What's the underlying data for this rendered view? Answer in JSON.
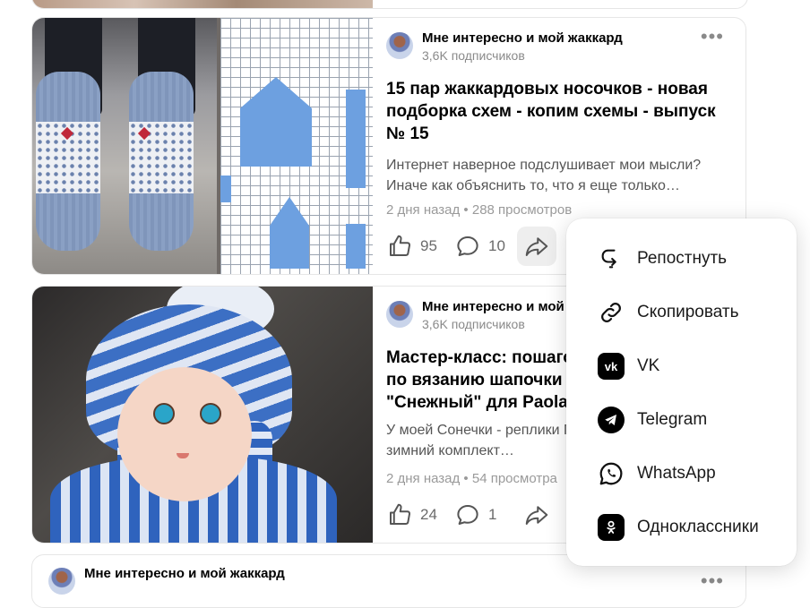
{
  "feed": {
    "items": [
      {
        "channel": "Мне интересно и мой жаккард",
        "subscribers": "3,6K подписчиков",
        "title": "15 пар жаккардовых носочков - новая подборка схем - копим схемы - выпуск № 15",
        "snippet": "Интернет наверное подслушивает мои мысли? Иначе как объяснить то, что я еще только…",
        "meta": "2 дня назад • 288 просмотров",
        "likes": "95",
        "comments": "10"
      },
      {
        "channel": "Мне интересно и мой жаккард",
        "subscribers": "3,6K подписчиков",
        "title": "Мастер-класс: пошаговое руководство по вязанию шапочки из комплекта \"Снежный\" для Paola Reina",
        "snippet": "У моей Сонечки - реплики Паолы появился теплый зимний комплект…",
        "meta": "2 дня назад • 54 просмотра",
        "likes": "24",
        "comments": "1"
      },
      {
        "channel": "Мне интересно и мой жаккард"
      }
    ],
    "more_icon": "more-dots-icon"
  },
  "share_menu": {
    "items": [
      {
        "label": "Репостнуть",
        "icon": "repost-icon"
      },
      {
        "label": "Скопировать",
        "icon": "link-icon"
      },
      {
        "label": "VK",
        "icon": "vk-icon"
      },
      {
        "label": "Telegram",
        "icon": "telegram-icon"
      },
      {
        "label": "WhatsApp",
        "icon": "whatsapp-icon"
      },
      {
        "label": "Одноклассники",
        "icon": "odnoklassniki-icon"
      }
    ]
  },
  "colors": {
    "accent_blue": "#6da0e0",
    "muted_text": "#8a8a8a",
    "popup_bg": "#ffffff"
  }
}
